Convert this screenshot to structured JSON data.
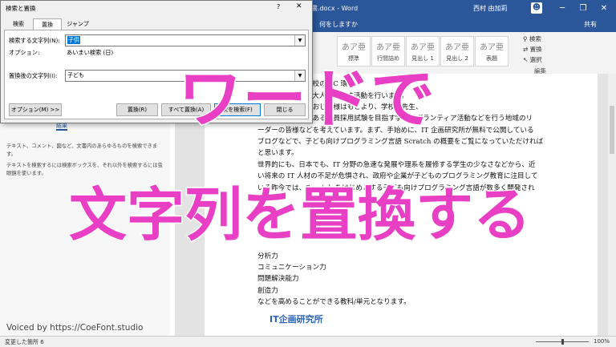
{
  "titlebar": {
    "doc_title": "文書.docx - Word",
    "user": "西村 由加莉",
    "min": "─",
    "restore": "❐",
    "close": "✕",
    "avatar_icon": "person-icon",
    "help": "?"
  },
  "tellbar": {
    "tell_me": "何をしますか",
    "share": "共有"
  },
  "ribbon": {
    "styles": [
      {
        "preview": "あア亜",
        "name": "標準"
      },
      {
        "preview": "あア亜",
        "name": "行間詰め"
      },
      {
        "preview": "あア亜",
        "name": "見出し 1"
      },
      {
        "preview": "あア亜",
        "name": "見出し 2"
      },
      {
        "preview": "あア亜",
        "name": "表題"
      }
    ],
    "editing": {
      "find": "検索",
      "replace": "置換",
      "select": "選択",
      "group_label": "編集"
    }
  },
  "nav_pane": {
    "tab_results": "結果",
    "help1": "テキスト、コメント、図など、文書内のあらゆるものを検索できます。",
    "help2": "テキストを検索するには検索ボックスを、それ以外を検索するには虫眼鏡を使います。"
  },
  "dialog": {
    "title": "検索と置換",
    "tabs": [
      "検索",
      "置換",
      "ジャンプ"
    ],
    "find_label": "検索する文字列(N):",
    "find_value": "子供",
    "options_label": "オプション:",
    "options_value": "あいまい検索 (日)",
    "replace_label": "置換後の文字列(I):",
    "replace_value": "子ども",
    "buttons": {
      "options": "オプション(M) >>",
      "replace": "置換(R)",
      "replace_all": "すべて置換(A)",
      "find_next": "次を検索(F)",
      "close": "閉じる"
    }
  },
  "document": {
    "lines": [
      "ために、家庭や学校の PC 環",
      "アドバイスできる大人を増やす活動を行います。",
      "お父様、お母様、おじい様はもとより、学校の先生、",
      "将来の先生候補である教員採用試験を目指す学生、ボランティア活動などを行う地域のリ",
      "ーダーの皆様などを考えています。まず、手始めに、IT 企画研究所が無料で公開している",
      "ブログなどで、子ども向けプログラミング言語 Scratch の概要をご覧になっていただければ",
      "と思います。",
      "世界的にも、日本でも、IT 分野の急速な発展や理系を履修する学生の少なさなどから、近",
      "い将来の IT 人材の不足が危惧され、政府や企業が子どものプログラミング教育に注目して",
      "いる昨今では、Scratch をはじめとする子ども向けプログラミング言語が数多く開発され",
      "",
      "",
      "",
      "",
      "分析力",
      "コミュニケーション力",
      "問題解決能力",
      "創造力",
      "などを高めることができる教科/単元となります。"
    ]
  },
  "status": {
    "changes": "変更した箇所 6",
    "zoom": "100%"
  },
  "overlay": {
    "title_line1": "ワードで",
    "title_line2": "文字列を置換する",
    "voiced": "Voiced by https://CoeFont.studio",
    "logo": "IT企画研究所"
  }
}
